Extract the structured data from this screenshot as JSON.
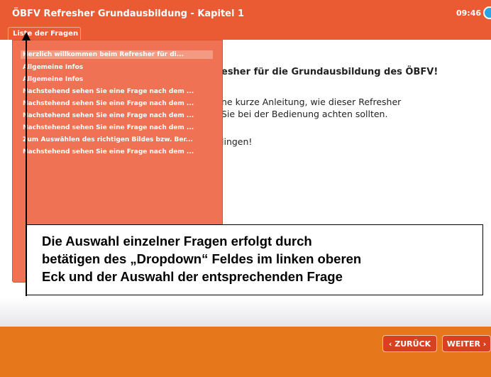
{
  "header": {
    "title": "ÖBFV Refresher Grundausbildung - Kapitel 1",
    "time": "09:46",
    "tab_label": "Liste der Fragen"
  },
  "content": {
    "heading": "esher für die Grundausbildung des ÖBFV!",
    "line1": "ne kurze Anleitung, wie dieser Refresher",
    "line2": "Sie bei der Bedienung achten sollten.",
    "line3": "lingen!"
  },
  "dropdown": {
    "items": [
      "Herzlich willkommen beim Refresher für di...",
      "Allgemeine Infos",
      "Allgemeine Infos",
      "Nachstehend sehen Sie eine Frage nach dem ...",
      "Nachstehend sehen Sie eine Frage nach dem ...",
      "Nachstehend sehen Sie eine Frage nach dem ...",
      "Nachstehend sehen Sie eine Frage nach dem ...",
      "Zum Auswählen des richtigen Bildes bzw. Ber...",
      "Nachstehend sehen Sie eine Frage nach dem ..."
    ]
  },
  "callout": {
    "line1": "Die Auswahl einzelner Fragen erfolgt durch",
    "line2": "betätigen des „Dropdown“ Feldes im linken oberen",
    "line3": "Eck und der Auswahl der entsprechenden Frage"
  },
  "footer": {
    "back_label": "‹ ZURÜCK",
    "next_label": "WEITER ›"
  },
  "colors": {
    "header": "#ea5b33",
    "footer": "#e6771a",
    "dropdown": "#ee7253",
    "clock_icon": "#29a3e4"
  },
  "icons": [
    "clock-icon",
    "arrow-up-icon"
  ]
}
